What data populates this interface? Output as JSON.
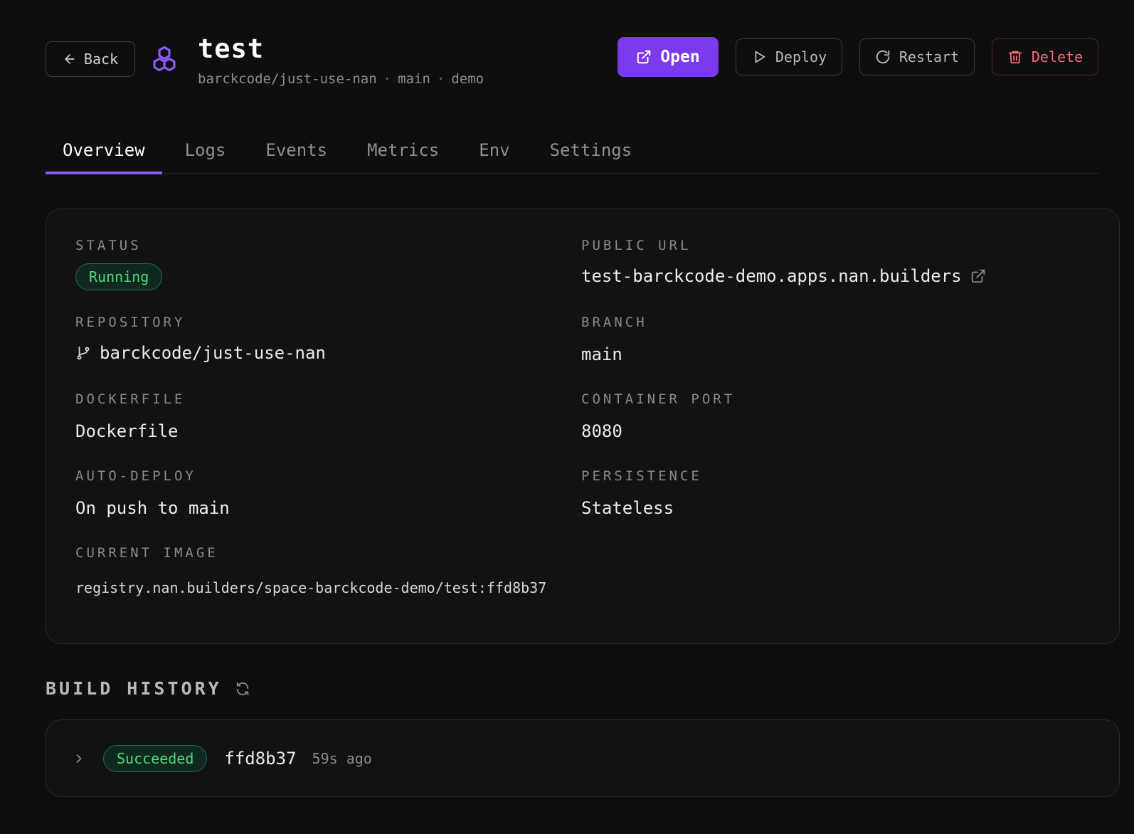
{
  "header": {
    "back_label": "Back",
    "title": "test",
    "repo": "barckcode/just-use-nan",
    "branch": "main",
    "space": "demo",
    "separator": "·"
  },
  "actions": {
    "open": "Open",
    "deploy": "Deploy",
    "restart": "Restart",
    "delete": "Delete"
  },
  "tabs": [
    "Overview",
    "Logs",
    "Events",
    "Metrics",
    "Env",
    "Settings"
  ],
  "active_tab": "Overview",
  "overview": {
    "status": {
      "label": "STATUS",
      "value": "Running"
    },
    "public_url": {
      "label": "PUBLIC URL",
      "value": "test-barckcode-demo.apps.nan.builders"
    },
    "repository": {
      "label": "REPOSITORY",
      "value": "barckcode/just-use-nan"
    },
    "branch": {
      "label": "BRANCH",
      "value": "main"
    },
    "dockerfile": {
      "label": "DOCKERFILE",
      "value": "Dockerfile"
    },
    "container_port": {
      "label": "CONTAINER PORT",
      "value": "8080"
    },
    "auto_deploy": {
      "label": "AUTO-DEPLOY",
      "value": "On push to main"
    },
    "persistence": {
      "label": "PERSISTENCE",
      "value": "Stateless"
    },
    "current_image": {
      "label": "CURRENT IMAGE",
      "value": "registry.nan.builders/space-barckcode-demo/test:ffd8b37"
    }
  },
  "build_history": {
    "title": "BUILD HISTORY",
    "builds": [
      {
        "status": "Succeeded",
        "hash": "ffd8b37",
        "time": "59s ago"
      }
    ]
  },
  "colors": {
    "accent": "#7c3aed",
    "success": "#4ade80",
    "danger": "#f07076",
    "background": "#0e0e0f"
  }
}
